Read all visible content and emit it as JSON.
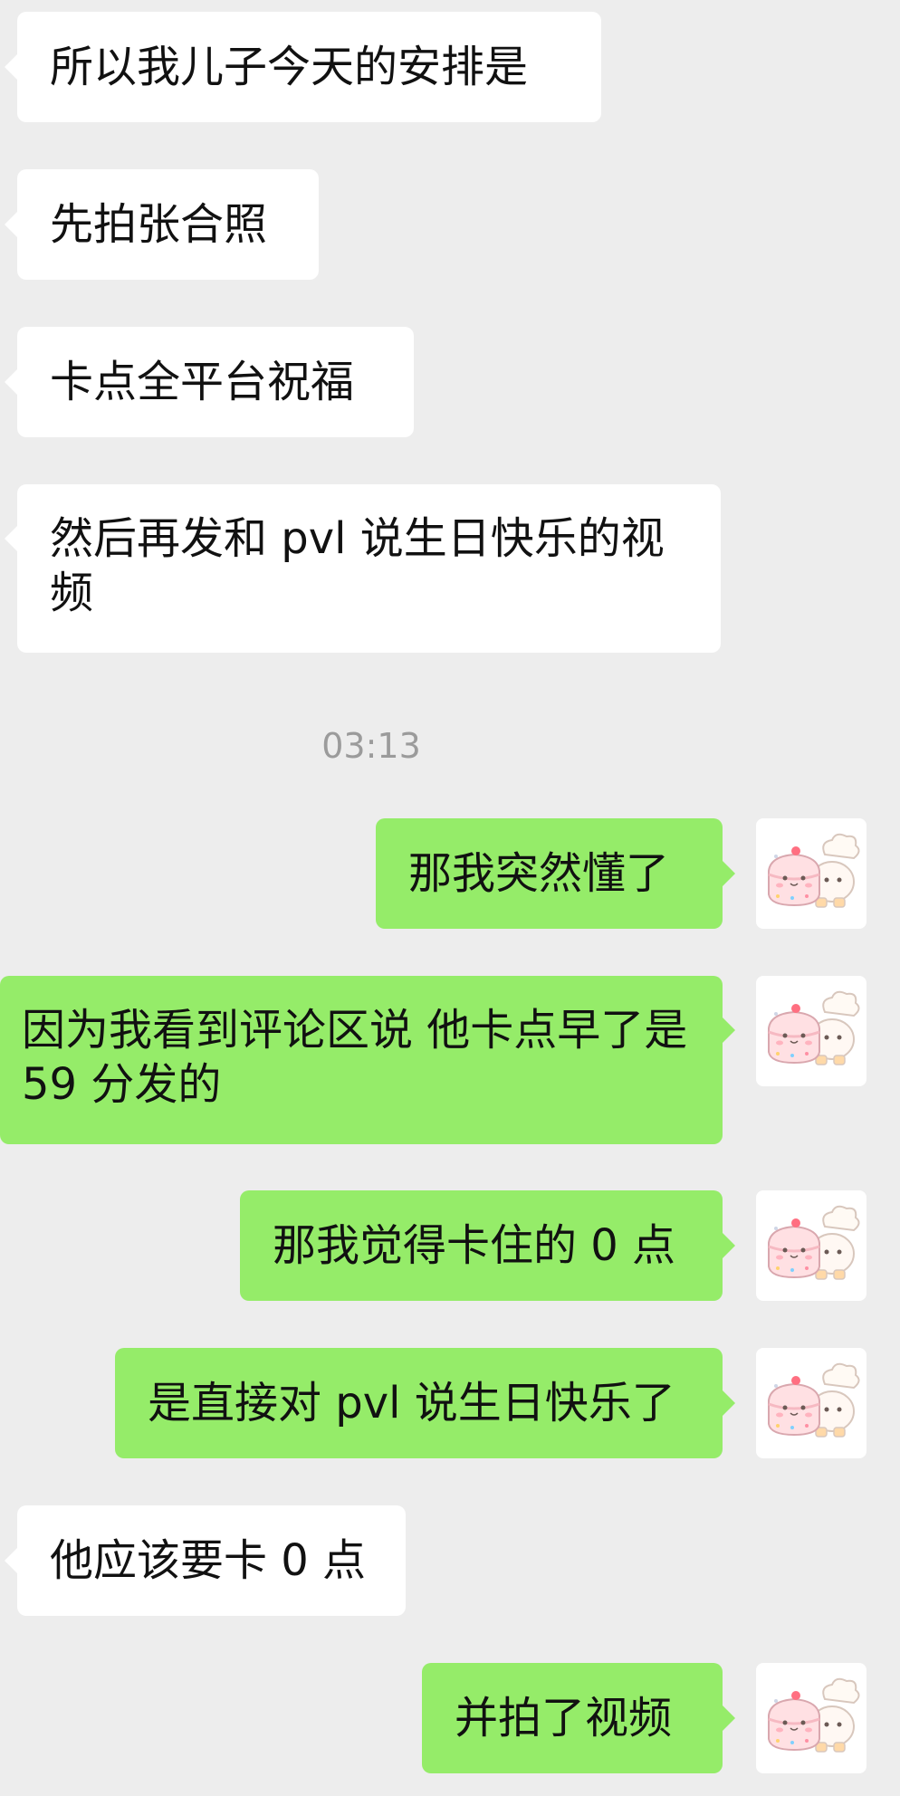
{
  "chat": {
    "messages": [
      {
        "side": "incoming",
        "text": "所以我儿子今天的安排是"
      },
      {
        "side": "incoming",
        "text": "先拍张合照"
      },
      {
        "side": "incoming",
        "text": "卡点全平台祝福"
      },
      {
        "side": "incoming",
        "text": "然后再发和 pvl 说生日快乐的视频"
      },
      {
        "side": "outgoing",
        "text": "那我突然懂了"
      },
      {
        "side": "outgoing",
        "text": "因为我看到评论区说 他卡点早了是 59 分发的"
      },
      {
        "side": "outgoing",
        "text": "那我觉得卡住的 0 点"
      },
      {
        "side": "outgoing",
        "text": "是直接对 pvl 说生日快乐了"
      },
      {
        "side": "incoming",
        "text": "他应该要卡 0 点"
      },
      {
        "side": "outgoing",
        "text": "并拍了视频"
      }
    ],
    "timestamp": "03:13"
  },
  "colors": {
    "background": "#ededed",
    "incoming_bubble": "#ffffff",
    "outgoing_bubble": "#95ec69",
    "timestamp_text": "#9b9b9b"
  },
  "icons": {
    "avatar": "cartoon-cake-and-cat-sticker-avatar"
  }
}
